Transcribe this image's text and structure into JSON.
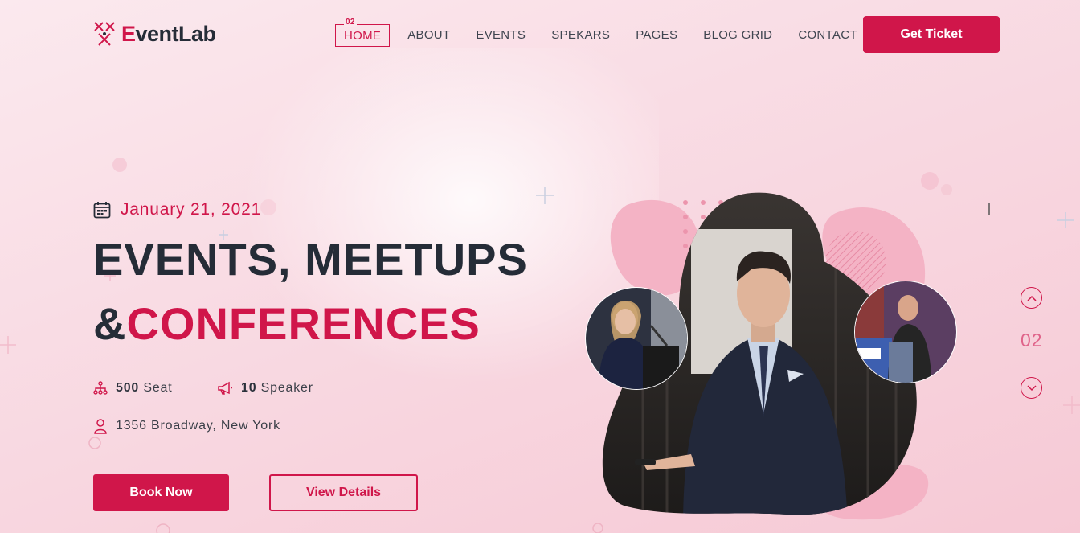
{
  "brand": {
    "name_first": "E",
    "name_rest": "ventLab"
  },
  "nav": {
    "active_number": "02",
    "items": [
      "HOME",
      "ABOUT",
      "EVENTS",
      "SPEKARS",
      "PAGES",
      "BLOG GRID",
      "CONTACT"
    ]
  },
  "header": {
    "cta_label": "Get Ticket"
  },
  "hero": {
    "date": "January 21, 2021",
    "title_line1": "EVENTS, MEETUPS",
    "title_line2_prefix": "&",
    "title_line2_highlight": "CONFERENCES",
    "seats_value": "500",
    "seats_label": " Seat",
    "speakers_value": "10",
    "speakers_label": " Speaker",
    "address": "1356 Broadway, New York",
    "book_label": "Book Now",
    "details_label": "View Details"
  },
  "slider": {
    "current": "02"
  },
  "icons": {
    "logo": "logo-mark-icon",
    "date": "calendar-icon",
    "seats": "sitemap-icon",
    "speakers": "megaphone-icon",
    "address": "user-icon",
    "prev": "chevron-up-icon",
    "next": "chevron-down-icon"
  },
  "colors": {
    "accent": "#d0164a",
    "text_dark": "#252c37",
    "background": "#f9dde5"
  }
}
